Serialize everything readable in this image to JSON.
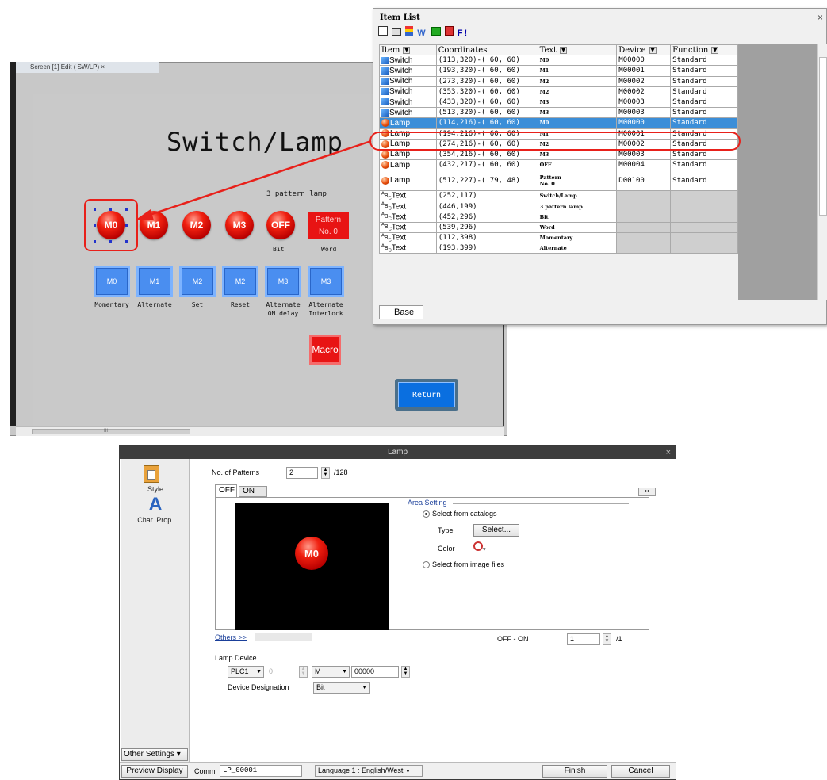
{
  "editor": {
    "tab_label": "Screen [1] Edit (        SW/LP)  ×",
    "screen_title": "Switch/Lamp",
    "pattern_lamp_heading": "3 pattern lamp",
    "lamps": [
      "M0",
      "M1",
      "M2",
      "M3",
      "OFF"
    ],
    "pattern_lamp": {
      "line1": "Pattern",
      "line2": "No. 0"
    },
    "bit_caption": "Bit",
    "word_caption": "Word",
    "switches": [
      {
        "label": "M0",
        "caption": "Momentary",
        "caption2": ""
      },
      {
        "label": "M1",
        "caption": "Alternate",
        "caption2": ""
      },
      {
        "label": "M2",
        "caption": "Set",
        "caption2": ""
      },
      {
        "label": "M2",
        "caption": "Reset",
        "caption2": ""
      },
      {
        "label": "M3",
        "caption": "Alternate",
        "caption2": "ON delay"
      },
      {
        "label": "M3",
        "caption": "Alternate",
        "caption2": "Interlock"
      }
    ],
    "macro_label": "Macro",
    "return_label": "Return",
    "scroll_marker": "III"
  },
  "item_list": {
    "title": "Item List",
    "close": "×",
    "toolbar_last": "F!",
    "columns": [
      "Item",
      "Coordinates",
      "Text",
      "Device",
      "Function"
    ],
    "rows": [
      {
        "icon": "switch",
        "item": "Switch",
        "coords": "(113,320)-( 60, 60)",
        "text": "M0",
        "device": "M00000",
        "function": "Standard",
        "selected": false
      },
      {
        "icon": "switch",
        "item": "Switch",
        "coords": "(193,320)-( 60, 60)",
        "text": "M1",
        "device": "M00001",
        "function": "Standard",
        "selected": false
      },
      {
        "icon": "switch",
        "item": "Switch",
        "coords": "(273,320)-( 60, 60)",
        "text": "M2",
        "device": "M00002",
        "function": "Standard",
        "selected": false
      },
      {
        "icon": "switch",
        "item": "Switch",
        "coords": "(353,320)-( 60, 60)",
        "text": "M2",
        "device": "M00002",
        "function": "Standard",
        "selected": false
      },
      {
        "icon": "switch",
        "item": "Switch",
        "coords": "(433,320)-( 60, 60)",
        "text": "M3",
        "device": "M00003",
        "function": "Standard",
        "selected": false
      },
      {
        "icon": "switch",
        "item": "Switch",
        "coords": "(513,320)-( 60, 60)",
        "text": "M3",
        "device": "M00003",
        "function": "Standard",
        "selected": false
      },
      {
        "icon": "lamp",
        "item": "Lamp",
        "coords": "(114,216)-( 60, 60)",
        "text": "M0",
        "device": "M00000",
        "function": "Standard",
        "selected": true
      },
      {
        "icon": "lamp",
        "item": "Lamp",
        "coords": "(194,216)-( 60, 60)",
        "text": "M1",
        "device": "M00001",
        "function": "Standard",
        "selected": false
      },
      {
        "icon": "lamp",
        "item": "Lamp",
        "coords": "(274,216)-( 60, 60)",
        "text": "M2",
        "device": "M00002",
        "function": "Standard",
        "selected": false
      },
      {
        "icon": "lamp",
        "item": "Lamp",
        "coords": "(354,216)-( 60, 60)",
        "text": "M3",
        "device": "M00003",
        "function": "Standard",
        "selected": false
      },
      {
        "icon": "lamp",
        "item": "Lamp",
        "coords": "(432,217)-( 60, 60)",
        "text": "OFF",
        "device": "M00004",
        "function": "Standard",
        "selected": false
      },
      {
        "icon": "lamp",
        "item": "Lamp",
        "coords": "(512,227)-( 79, 48)",
        "text": "Pattern",
        "text2": "No. 0",
        "device": "D00100",
        "function": "Standard",
        "selected": false
      },
      {
        "icon": "text",
        "item": "Text",
        "coords": "(252,117)",
        "text": "Switch/Lamp",
        "device": "",
        "function": "",
        "selected": false
      },
      {
        "icon": "text",
        "item": "Text",
        "coords": "(446,199)",
        "text": "3 pattern lamp",
        "device": "",
        "function": "",
        "selected": false
      },
      {
        "icon": "text",
        "item": "Text",
        "coords": "(452,296)",
        "text": "Bit",
        "device": "",
        "function": "",
        "selected": false
      },
      {
        "icon": "text",
        "item": "Text",
        "coords": "(539,296)",
        "text": "Word",
        "device": "",
        "function": "",
        "selected": false
      },
      {
        "icon": "text",
        "item": "Text",
        "coords": "(112,398)",
        "text": "Momentary",
        "device": "",
        "function": "",
        "selected": false
      },
      {
        "icon": "text",
        "item": "Text",
        "coords": "(193,399)",
        "text": "Alternate",
        "device": "",
        "function": "",
        "selected": false
      }
    ],
    "bottom_tab": "Base"
  },
  "lamp_dialog": {
    "title": "Lamp",
    "close": "×",
    "side_items": [
      "Style",
      "Char. Prop."
    ],
    "other_settings": "Other Settings",
    "no_of_patterns_label": "No. of Patterns",
    "no_of_patterns_value": "2",
    "no_of_patterns_max": "/128",
    "tabs": [
      "OFF",
      "ON"
    ],
    "area_setting_label": "Area Setting",
    "select_from_catalogs": "Select from catalogs",
    "type_label": "Type",
    "select_button": "Select...",
    "color_label": "Color",
    "select_from_image_files": "Select from image files",
    "preview_lamp_text": "M0",
    "lamp_device_caption": "Lamp Device",
    "lamp_device_value": "M00000",
    "others_link": "Others >>",
    "off_on_label": "OFF - ON",
    "off_on_value": "1",
    "off_on_max": "/1",
    "lamp_device_section": "Lamp Device",
    "plc": "PLC1",
    "station": "0",
    "device_type": "M",
    "address": "00000",
    "device_designation_label": "Device Designation",
    "device_designation_value": "Bit",
    "preview_display": "Preview Display",
    "comm_label": "Comm",
    "comm_value": "LP_00001",
    "language": "Language 1 : English/West",
    "finish": "Finish",
    "cancel": "Cancel"
  },
  "colors": {
    "lamp_red": "#f02010",
    "switch_blue": "#4a8ef0",
    "selection_blue": "#3b8ed8",
    "callout_red": "#e8201a"
  }
}
